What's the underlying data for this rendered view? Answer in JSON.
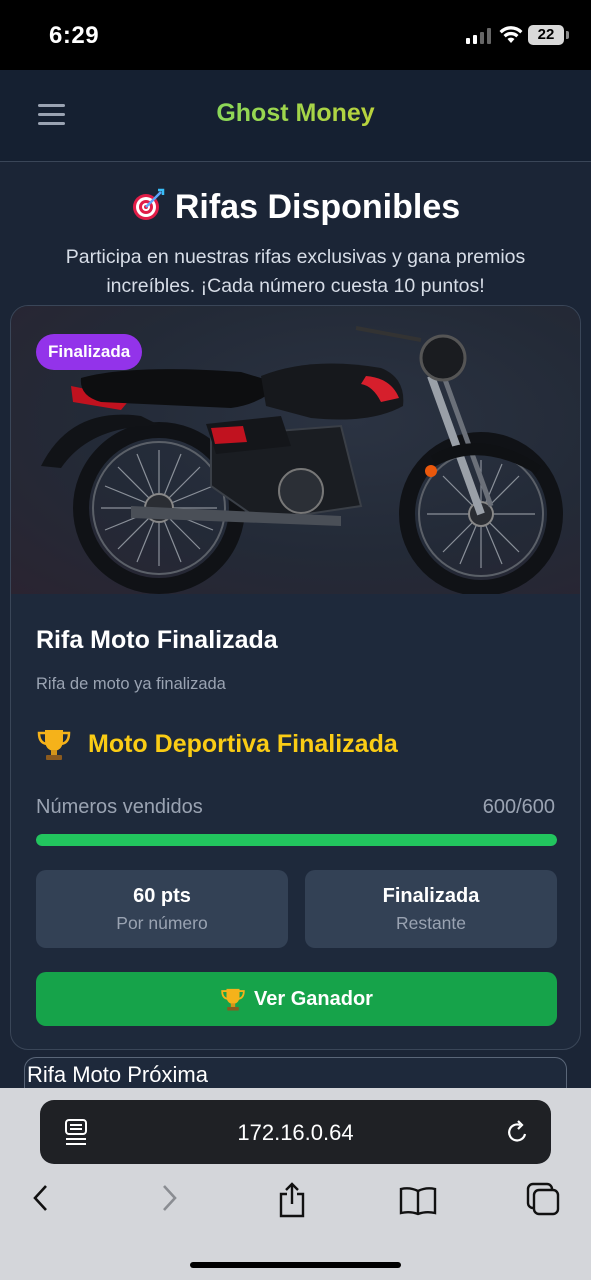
{
  "status_bar": {
    "time": "6:29",
    "battery": "22"
  },
  "header": {
    "app_title": "Ghost Money",
    "menu_icon": "hamburger-menu-icon"
  },
  "page": {
    "title": "Rifas Disponibles",
    "title_icon": "target-icon",
    "subtitle": "Participa en nuestras rifas exclusivas y gana premios increíbles. ¡Cada número cuesta 10 puntos!"
  },
  "raffle": {
    "status_badge": "Finalizada",
    "image": "motorcycle-image",
    "title": "Rifa Moto Finalizada",
    "description": "Rifa de moto ya finalizada",
    "prize_icon": "trophy-icon",
    "prize_name": "Moto Deportiva Finalizada",
    "sold_label": "Números vendidos",
    "sold_value": "600/600",
    "sold_fraction": 1.0,
    "price_value": "60 pts",
    "price_label": "Por número",
    "remaining_value": "Finalizada",
    "remaining_label": "Restante",
    "action_label": "Ver Ganador"
  },
  "next_raffle": {
    "title": "Rifa Moto Próxima"
  },
  "browser": {
    "url": "172.16.0.64"
  },
  "colors": {
    "background": "#1b2536",
    "card": "#1e293b",
    "badge": "#9333ea",
    "prize": "#facc15",
    "progress": "#22c55e",
    "action": "#16a34a"
  }
}
